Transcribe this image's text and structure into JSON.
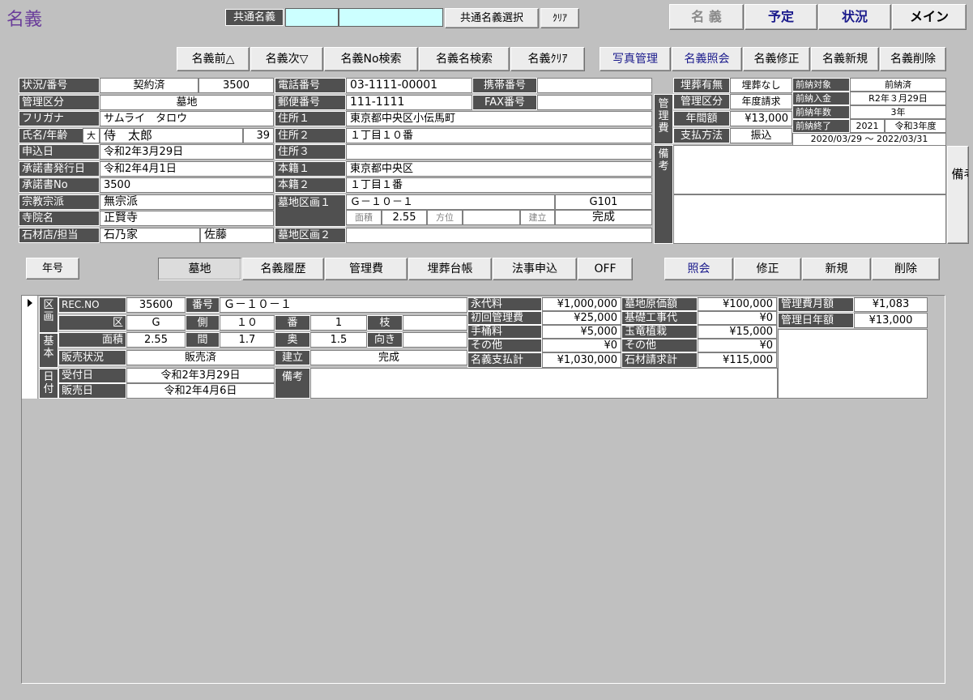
{
  "window": {
    "title": "名義"
  },
  "common_name": {
    "label": "共通名義",
    "select_button": "共通名義選択",
    "clear_button": "ｸﾘｱ",
    "value1": "",
    "value2": ""
  },
  "top_nav": {
    "name": "名 義",
    "schedule": "予定",
    "status": "状況",
    "main": "メイン"
  },
  "name_buttons": {
    "prev": "名義前△",
    "next": "名義次▽",
    "no_search": "名義No検索",
    "name_search": "名義名検索",
    "clear": "名義ｸﾘｱ"
  },
  "action_buttons": {
    "photo": "写真管理",
    "inquiry": "名義照会",
    "modify": "名義修正",
    "new": "名義新規",
    "delete": "名義削除"
  },
  "person": {
    "status_label": "状況/番号",
    "status": "契約済",
    "number": "3500",
    "mgmt_label": "管理区分",
    "mgmt": "墓地",
    "furigana_label": "フリガナ",
    "furigana": "サムライ　タロウ",
    "name_label": "氏名/年齢",
    "era_badge": "大",
    "name": "侍　太郎",
    "age": "39",
    "apply_label": "申込日",
    "apply_date": "令和2年3月29日",
    "consent_label": "承諾書発行日",
    "consent_date": "令和2年4月1日",
    "consent_no_label": "承諾書No",
    "consent_no": "3500",
    "religion_label": "宗教宗派",
    "religion": "無宗派",
    "temple_label": "寺院名",
    "temple": "正賢寺",
    "stone_label": "石材店/担当",
    "stone": "石乃家",
    "staff": "佐藤"
  },
  "contact": {
    "phone_label": "電話番号",
    "phone": "03-1111-00001",
    "mobile_label": "携帯番号",
    "mobile": "",
    "postal_label": "郵便番号",
    "postal": "111-1111",
    "fax_label": "FAX番号",
    "fax": "",
    "addr1_label": "住所１",
    "addr1": "東京都中央区小伝馬町",
    "addr2_label": "住所２",
    "addr2": "１丁目１０番",
    "addr3_label": "住所３",
    "addr3": "",
    "honseki1_label": "本籍１",
    "honseki1": "東京都中央区",
    "honseki2_label": "本籍２",
    "honseki2": "１丁目１番",
    "plot1_label": "墓地区画１",
    "plot1": "Ｇ－１０－１",
    "plot1_code": "G101",
    "area_label": "面積",
    "area": "2.55",
    "direction_label": "方位",
    "direction": "",
    "built_label": "建立",
    "built": "完成",
    "plot2_label": "墓地区画２",
    "plot2": ""
  },
  "burial": {
    "exist_label": "埋葬有無",
    "exist": "埋葬なし",
    "group_label": "管理費",
    "mgmt_label": "管理区分",
    "mgmt": "年度請求",
    "annual_label": "年間額",
    "annual": "¥13,000",
    "pay_label": "支払方法",
    "pay": "振込"
  },
  "prepay": {
    "target_label": "前納対象",
    "target": "前納済",
    "income_label": "前納入金",
    "income": "R2年３月29日",
    "years_label": "前納年数",
    "years": "3年",
    "end_label": "前納終了",
    "end_year": "2021",
    "end_era": "令和3年度",
    "period": "2020/03/29 ～ 2022/03/31"
  },
  "remarks": {
    "label": "備考",
    "text1": "",
    "text2": "",
    "expand_button": "備考拡張"
  },
  "mid_buttons": {
    "year": "年号",
    "inquiry": "照会",
    "modify": "修正",
    "new": "新規",
    "delete": "削除"
  },
  "tabs": [
    "墓地",
    "名義履歴",
    "管理費",
    "埋葬台帳",
    "法事申込",
    "OFF"
  ],
  "grave": {
    "side_plot": "区画",
    "side_basic": "基本",
    "side_date": "日付",
    "recno_label": "REC.NO",
    "recno": "35600",
    "bango_label": "番号",
    "bango": "Ｇ－１０－１",
    "ku_label": "区",
    "ku": "G",
    "gawa_label": "側",
    "gawa": "１０",
    "ban_label": "番",
    "ban": "1",
    "eda_label": "枝",
    "eda": "",
    "area_label": "面積",
    "area": "2.55",
    "ma_label": "間",
    "ma": "1.7",
    "oku_label": "奥",
    "oku": "1.5",
    "muki_label": "向き",
    "muki": "",
    "sale_label": "販売状況",
    "sale": "販売済",
    "built_label": "建立",
    "built": "完成",
    "recv_label": "受付日",
    "recv": "令和2年3月29日",
    "sold_label": "販売日",
    "sold": "令和2年4月6日",
    "remark_label": "備考",
    "remark": ""
  },
  "fees": {
    "eidai_label": "永代料",
    "eidai": "¥1,000,000",
    "first_label": "初回管理費",
    "first": "¥25,000",
    "tesuu_label": "手桶料",
    "tesuu": "¥5,000",
    "other_label": "その他",
    "other": "¥0",
    "total_label": "名義支払計",
    "total": "¥1,030,000"
  },
  "stone_fees": {
    "cost_label": "墓地原価額",
    "cost": "¥100,000",
    "kiso_label": "基礎工事代",
    "kiso": "¥0",
    "tamagaki_label": "玉竜植栽",
    "tamagaki": "¥15,000",
    "other_label": "その他",
    "other": "¥0",
    "total_label": "石材請求計",
    "total": "¥115,000"
  },
  "mgmt_fees": {
    "monthly_label": "管理費月額",
    "monthly": "¥1,083",
    "daily_label": "管理日年額",
    "daily": "¥13,000"
  },
  "colors": {
    "label_bg": "#505050",
    "panel_bg": "#c0c0c0",
    "accent": "#1a1a8c"
  }
}
